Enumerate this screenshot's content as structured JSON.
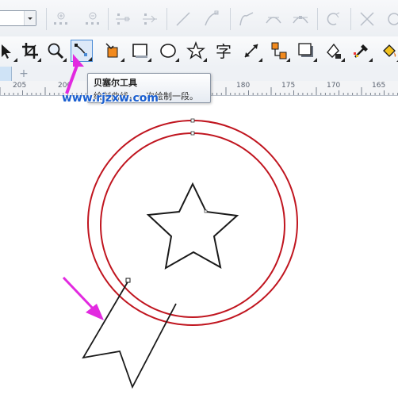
{
  "property_bar": {
    "icons": [
      "dropdown",
      "add-node-icon",
      "delete-node-icon",
      "join-nodes-icon",
      "break-curve-icon",
      "to-line-icon",
      "to-curve-icon",
      "cusp-node-icon",
      "smooth-node-icon",
      "symmetrical-node-icon",
      "reverse-direction-icon",
      "extend-curve-icon"
    ]
  },
  "toolbox": {
    "tools": [
      {
        "name": "pick-tool-icon"
      },
      {
        "name": "crop-tool-icon"
      },
      {
        "name": "zoom-tool-icon"
      },
      {
        "name": "bezier-tool-icon",
        "active": true
      },
      {
        "name": "smart-fill-tool-icon"
      },
      {
        "name": "rectangle-tool-icon"
      },
      {
        "name": "ellipse-tool-icon"
      },
      {
        "name": "star-tool-icon"
      },
      {
        "name": "text-tool-icon",
        "glyph": "字"
      },
      {
        "name": "dimension-tool-icon"
      },
      {
        "name": "connector-tool-icon"
      },
      {
        "name": "drop-shadow-tool-icon"
      },
      {
        "name": "transparency-tool-icon"
      },
      {
        "name": "eyedropper-tool-icon"
      },
      {
        "name": "fill-tool-icon"
      }
    ]
  },
  "tabs": {
    "add_label": "+"
  },
  "ruler": {
    "labels": [
      "205",
      "200",
      "180",
      "175",
      "170",
      "165"
    ]
  },
  "tooltip": {
    "title": "贝塞尔工具",
    "body": "绘制曲线，一次绘制一段。"
  },
  "watermark": "www.rjzxw.com",
  "colors": {
    "circle_stroke": "#c0151f",
    "shape_stroke": "#1a1a1a",
    "arrow_magenta": "#e22ae0",
    "watermark_blue": "#1a5fd0",
    "active_tool_border": "#4a8bd6"
  }
}
